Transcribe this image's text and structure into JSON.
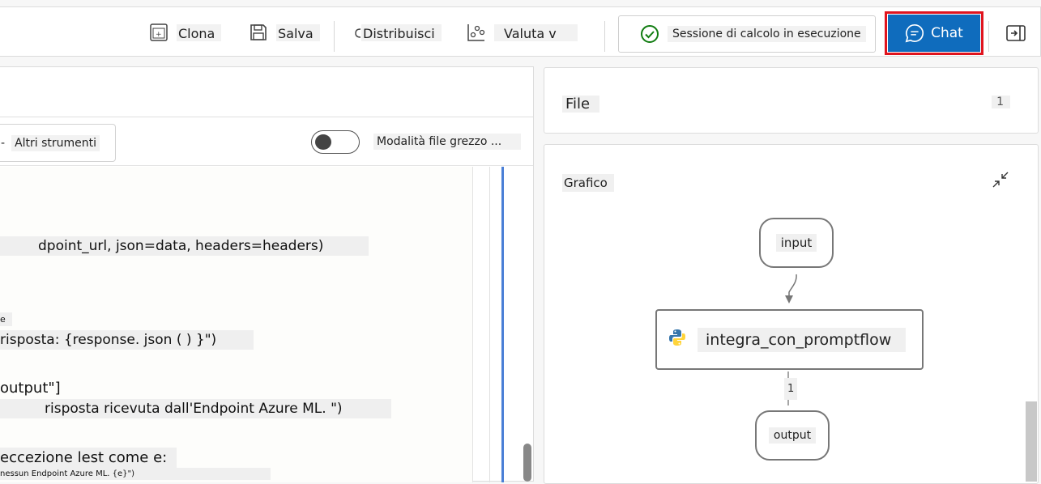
{
  "toolbar": {
    "clone_label": "Clona",
    "save_label": "Salva",
    "deploy_label": "Distribuisci",
    "evaluate_label": "Valuta v",
    "status_text": "Sessione di calcolo in esecuzione",
    "chat_label": "Chat"
  },
  "editor": {
    "more_tools_prefix": "-",
    "more_tools_label": "Altri strumenti",
    "raw_mode_label": "Modalità file grezzo ...",
    "raw_mode_on": false,
    "lines": [
      "dpoint_url, json=data, headers=headers)",
      ")",
      "e",
      "risposta: {response. json ( ) }\")",
      "output\"]",
      "risposta ricevuta dall'Endpoint Azure ML. \")",
      "eccezione lest come e:",
      "nessun Endpoint Azure ML. {e}\")"
    ]
  },
  "files": {
    "title": "File",
    "count": "1"
  },
  "graph": {
    "title": "Grafico",
    "input_node": "input",
    "step_node": "integra_con_promptflow",
    "edge_label": "1",
    "output_node": "output"
  },
  "colors": {
    "accent": "#0f6cbd",
    "highlight_border": "#e0141e",
    "status_ok": "#107c10",
    "python_blue": "#3776ab",
    "python_yellow": "#ffd43b"
  }
}
